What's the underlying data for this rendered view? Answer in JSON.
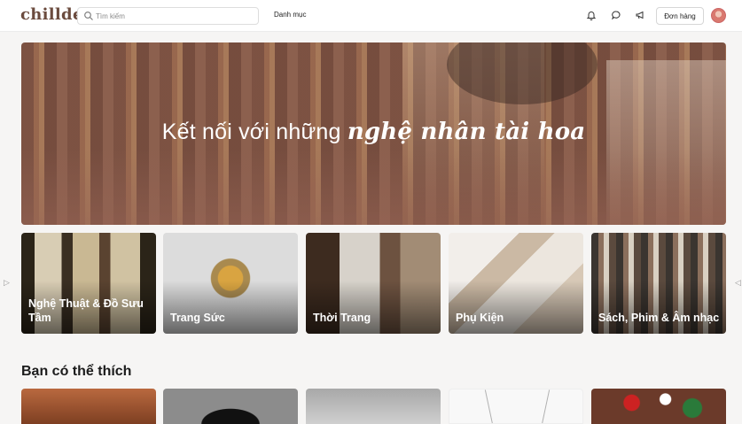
{
  "header": {
    "logo": "chillde",
    "search_placeholder": "Tìm kiếm",
    "category_menu": "Danh mục",
    "icons": [
      "bell-icon",
      "chat-icon",
      "megaphone-icon"
    ],
    "orders_button": "Đơn hàng"
  },
  "hero": {
    "title_regular": "Kết nối với những",
    "title_emphasis": "nghệ nhân tài hoa"
  },
  "categories": [
    {
      "label": "Nghệ Thuật & Đồ Sưu Tầm"
    },
    {
      "label": "Trang Sức"
    },
    {
      "label": "Thời Trang"
    },
    {
      "label": "Phụ Kiện"
    },
    {
      "label": "Sách, Phim & Âm nhạc"
    }
  ],
  "carousel": {
    "prev_icon": "chevron-left-icon",
    "next_icon": "chevron-right-icon"
  },
  "recommendations": {
    "title": "Bạn có thể thích"
  },
  "colors": {
    "brand": "#6b4b3e",
    "hero_overlay": "#8c5848"
  }
}
